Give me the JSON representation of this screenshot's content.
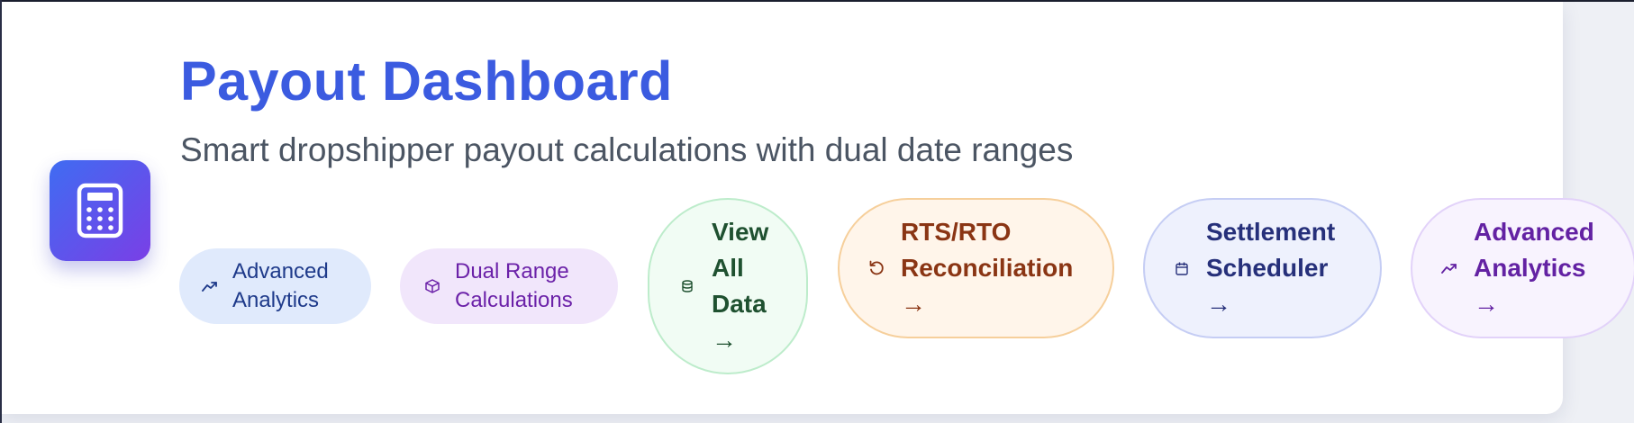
{
  "header": {
    "title": "Payout Dashboard",
    "subtitle": "Smart dropshipper payout calculations with dual date ranges",
    "app_icon": "calculator-icon"
  },
  "badges": [
    {
      "label": "Advanced Analytics",
      "icon": "trending-up-icon"
    },
    {
      "label": "Dual Range Calculations",
      "icon": "package-icon"
    }
  ],
  "actions": [
    {
      "label": "View All Data →",
      "icon": "database-icon"
    },
    {
      "label": "RTS/RTO Reconciliation →",
      "icon": "refresh-icon"
    },
    {
      "label": "Settlement Scheduler →",
      "icon": "calendar-icon"
    },
    {
      "label": "Advanced Analytics →",
      "icon": "trending-up-icon"
    }
  ],
  "colors": {
    "title": "#3b5be0",
    "icon_gradient_start": "#3f6cf2",
    "icon_gradient_end": "#7a3fe6"
  }
}
